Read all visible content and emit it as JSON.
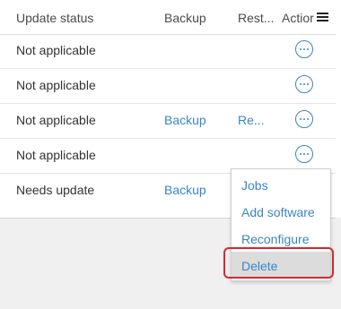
{
  "table": {
    "columns": {
      "update_status": "Update status",
      "backup": "Backup",
      "restore": "Rest...",
      "actions": "Actior"
    },
    "rows": [
      {
        "status": "Not applicable",
        "backup": "",
        "restore": ""
      },
      {
        "status": "Not applicable",
        "backup": "",
        "restore": ""
      },
      {
        "status": "Not applicable",
        "backup": "Backup",
        "restore": "Re..."
      },
      {
        "status": "Not applicable",
        "backup": "",
        "restore": ""
      },
      {
        "status": "Needs update",
        "backup": "Backup",
        "restore": ""
      }
    ]
  },
  "dropdown": {
    "items": [
      "Jobs",
      "Add software",
      "Reconfigure",
      "Delete"
    ],
    "highlighted": "Delete"
  },
  "icons": {
    "row_action": "more-horizontal-icon",
    "column_menu": "hamburger-menu-icon"
  },
  "colors": {
    "link": "#3a85c6",
    "highlight_border": "#d9262c"
  }
}
